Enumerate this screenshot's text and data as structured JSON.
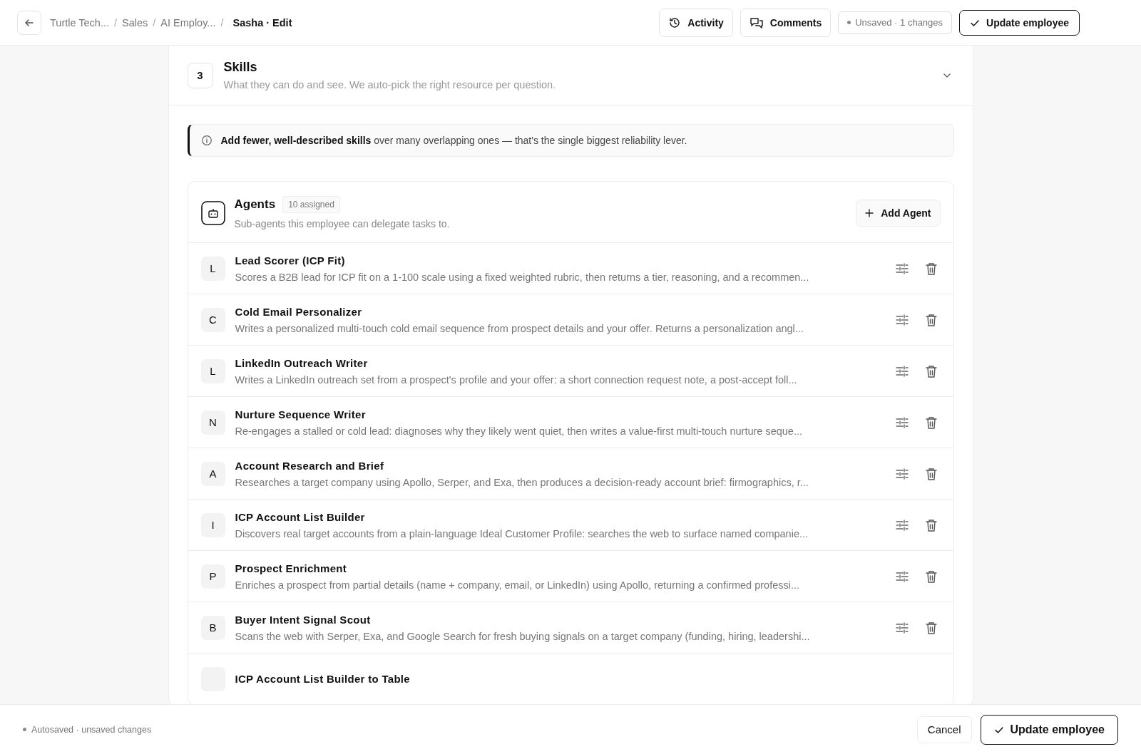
{
  "breadcrumbs": [
    "Turtle Tech...",
    "Sales",
    "AI Employ...",
    "Sasha · Edit"
  ],
  "breadcrumb_separator": "/",
  "header_actions": {
    "activity": "Activity",
    "comments": "Comments",
    "status": "Unsaved · 1 changes",
    "update": "Update employee"
  },
  "section": {
    "number": "3",
    "title": "Skills",
    "subtitle": "What they can do and see. We auto-pick the right resource per question.",
    "expanded": true
  },
  "tip": "**Add fewer, well-described skills** over many overlapping ones — that's the single biggest reliability lever.",
  "agents": {
    "title": "Agents",
    "count": "10 assigned",
    "subtitle": "Sub-agents this employee can delegate tasks to.",
    "add_button": "Add Agent",
    "items": [
      {
        "initial": "L",
        "name": "Lead Scorer (ICP Fit)",
        "description": "Scores a B2B lead for ICP fit on a 1-100 scale using a fixed weighted rubric, then returns a tier, reasoning, and a recommen..."
      },
      {
        "initial": "C",
        "name": "Cold Email Personalizer",
        "description": "Writes a personalized multi-touch cold email sequence from prospect details and your offer. Returns a personalization angl..."
      },
      {
        "initial": "L",
        "name": "LinkedIn Outreach Writer",
        "description": "Writes a LinkedIn outreach set from a prospect's profile and your offer: a short connection request note, a post-accept foll..."
      },
      {
        "initial": "N",
        "name": "Nurture Sequence Writer",
        "description": "Re-engages a stalled or cold lead: diagnoses why they likely went quiet, then writes a value-first multi-touch nurture seque..."
      },
      {
        "initial": "A",
        "name": "Account Research and Brief",
        "description": "Researches a target company using Apollo, Serper, and Exa, then produces a decision-ready account brief: firmographics, r..."
      },
      {
        "initial": "I",
        "name": "ICP Account List Builder",
        "description": "Discovers real target accounts from a plain-language Ideal Customer Profile: searches the web to surface named companie..."
      },
      {
        "initial": "P",
        "name": "Prospect Enrichment",
        "description": "Enriches a prospect from partial details (name + company, email, or LinkedIn) using Apollo, returning a confirmed professi..."
      },
      {
        "initial": "B",
        "name": "Buyer Intent Signal Scout",
        "description": "Scans the web with Serper, Exa, and Google Search for fresh buying signals on a target company (funding, hiring, leadershi..."
      },
      {
        "name": "ICP Account List Builder to Table"
      }
    ]
  },
  "footer": {
    "status": "Autosaved · unsaved changes",
    "cancel": "Cancel",
    "update": "Update employee"
  }
}
